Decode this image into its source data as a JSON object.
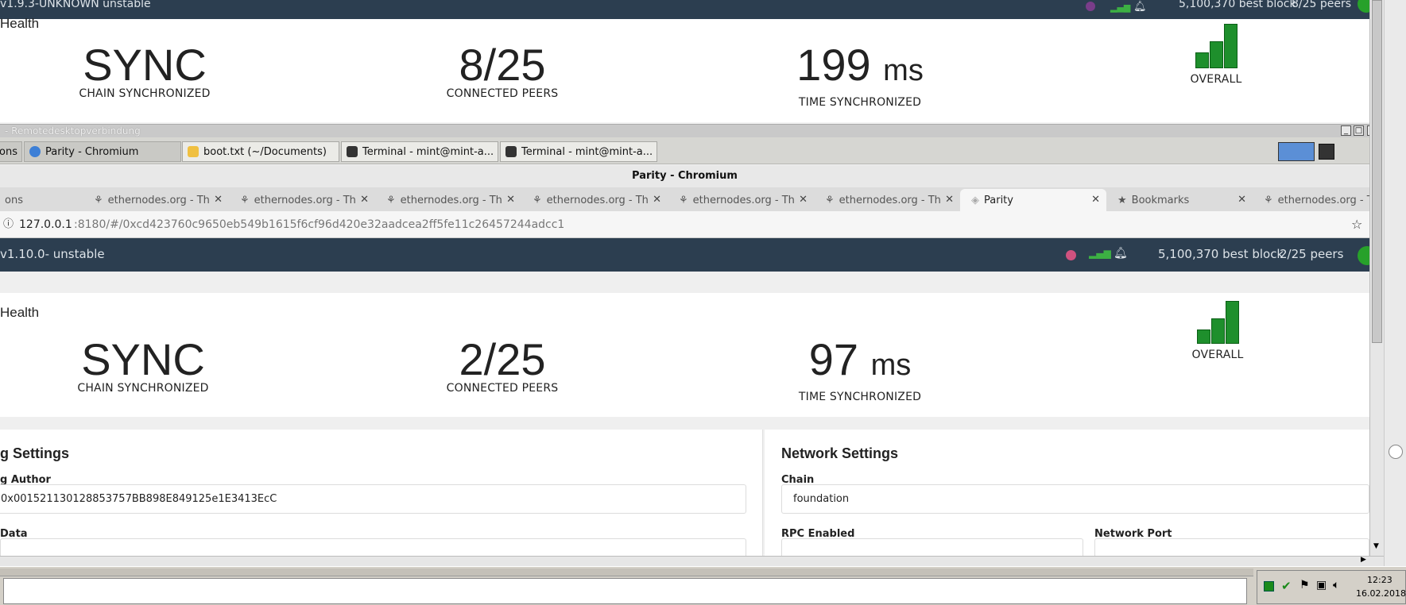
{
  "top_window": {
    "version": "v1.9.3-UNKNOWN unstable",
    "best_block": "5,100,370 best block",
    "peers": "8/25 peers",
    "section_title": "Health",
    "metrics": [
      {
        "value": "SYNC",
        "unit": "",
        "caption": "CHAIN SYNCHRONIZED"
      },
      {
        "value": "8/25",
        "unit": "",
        "caption": "CONNECTED PEERS"
      },
      {
        "value": "199",
        "unit": "ms",
        "caption": "TIME SYNCHRONIZED"
      },
      {
        "value": "",
        "unit": "",
        "caption": "OVERALL"
      }
    ]
  },
  "rdp": {
    "title": "- Remotedesktopverbindung"
  },
  "tasks": [
    {
      "label": "ons",
      "active": false
    },
    {
      "label": "Parity - Chromium",
      "active": true
    },
    {
      "label": "boot.txt (~/Documents)",
      "active": false
    },
    {
      "label": "Terminal - mint@mint-a...",
      "active": false
    },
    {
      "label": "Terminal - mint@mint-a...",
      "active": false
    }
  ],
  "chrome": {
    "window_title": "Parity - Chromium",
    "tabs": [
      {
        "label": "ons",
        "active": false
      },
      {
        "label": "ethernodes.org - Th",
        "active": false
      },
      {
        "label": "ethernodes.org - Th",
        "active": false
      },
      {
        "label": "ethernodes.org - Th",
        "active": false
      },
      {
        "label": "ethernodes.org - Th",
        "active": false
      },
      {
        "label": "ethernodes.org - Th",
        "active": false
      },
      {
        "label": "ethernodes.org - Th",
        "active": false
      },
      {
        "label": "Parity",
        "active": true
      },
      {
        "label": "Bookmarks",
        "active": false
      },
      {
        "label": "ethernodes.org - Th",
        "active": false
      }
    ],
    "url_host": "127.0.0.1",
    "url_rest": ":8180/#/0xcd423760c9650eb549b1615f6cf96d420e32aadcea2ff5fe11c26457244adcc1"
  },
  "parity": {
    "version": "v1.10.0- unstable",
    "best_block": "5,100,370 best block",
    "peers": "2/25 peers",
    "section_title": "Health",
    "metrics": [
      {
        "value": "SYNC",
        "unit": "",
        "caption": "CHAIN SYNCHRONIZED"
      },
      {
        "value": "2/25",
        "unit": "",
        "caption": "CONNECTED PEERS"
      },
      {
        "value": "97",
        "unit": "ms",
        "caption": "TIME SYNCHRONIZED"
      },
      {
        "value": "",
        "unit": "",
        "caption": "OVERALL"
      }
    ],
    "mining": {
      "title": "g Settings",
      "author_label": "g Author",
      "author_value": "0x001521130128853757BB898E849125e1E3413EcC",
      "data_label": "Data"
    },
    "network": {
      "title": "Network Settings",
      "chain_label": "Chain",
      "chain_value": "foundation",
      "rpc_label": "RPC Enabled",
      "port_label": "Network Port"
    }
  },
  "clock": {
    "time": "12:23",
    "date": "16.02.2018"
  },
  "colors": {
    "header": "#2c3e50",
    "health_green": "#1e8f2c",
    "avatar_green": "#27a12a",
    "status_pink": "#d0527f"
  }
}
